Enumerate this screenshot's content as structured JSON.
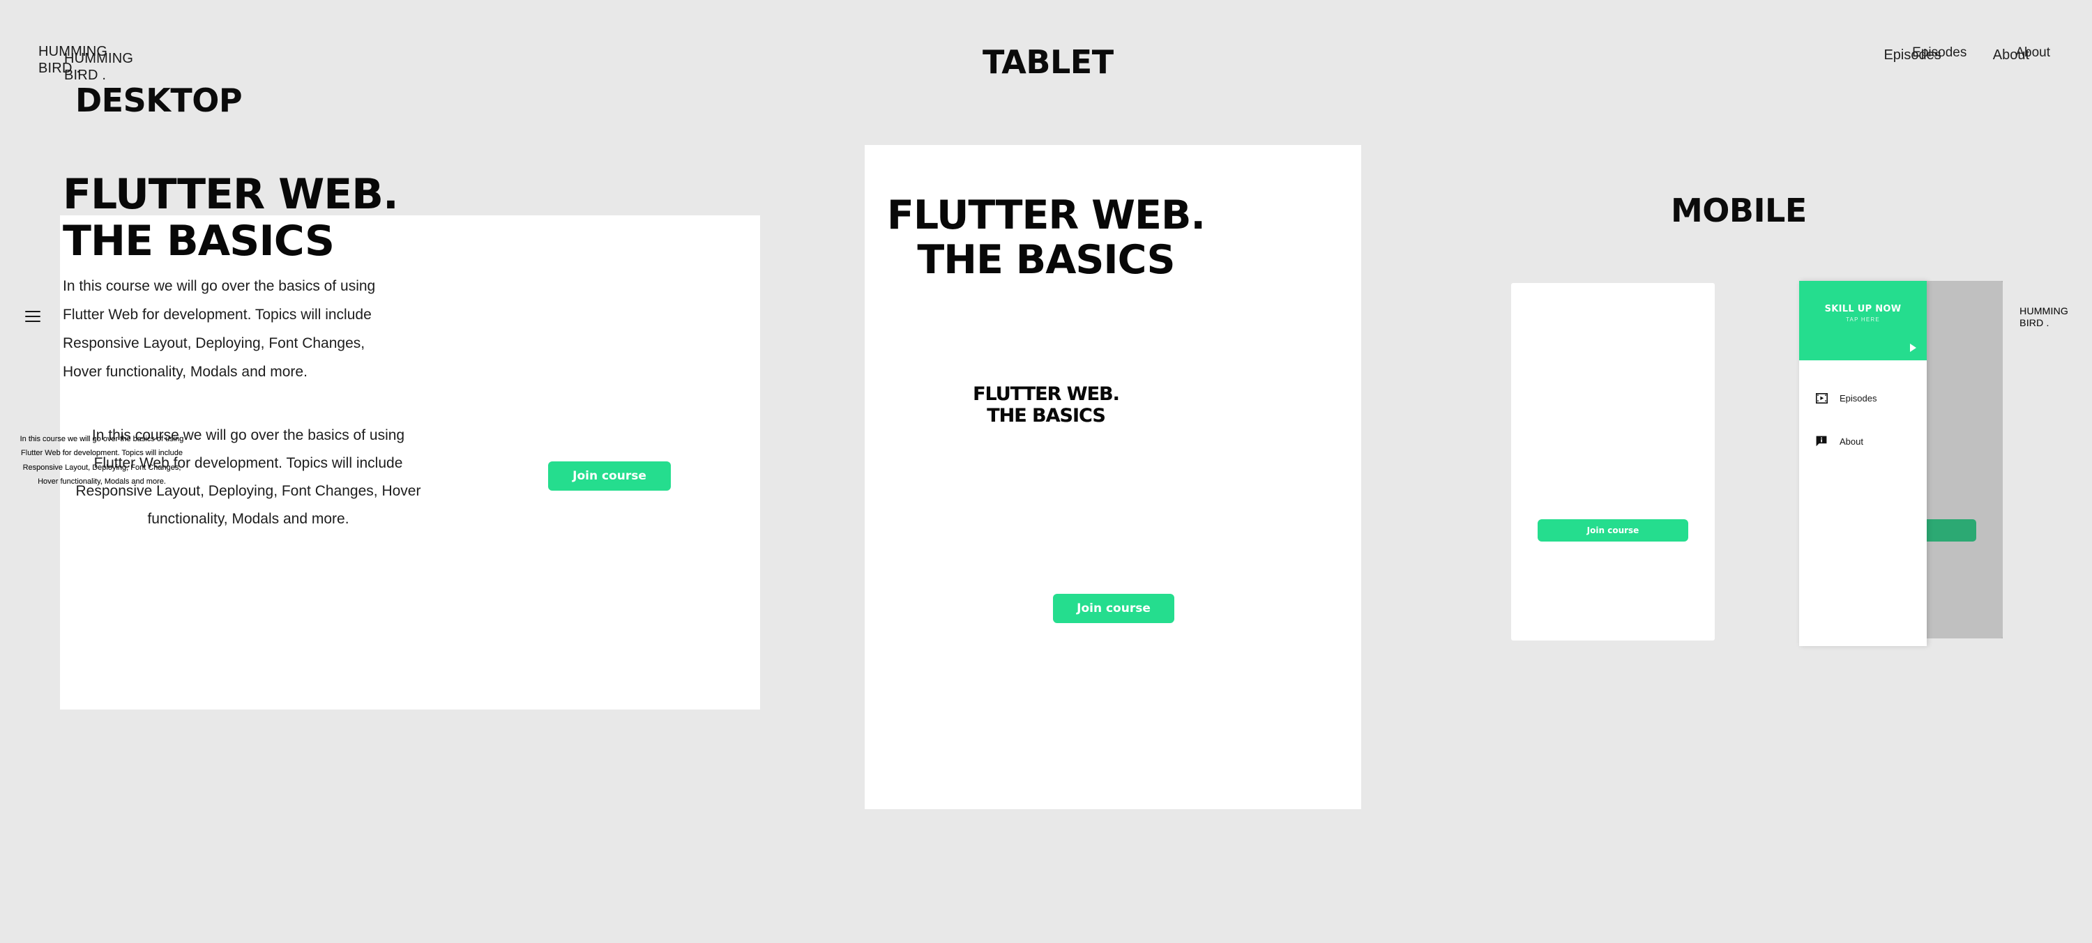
{
  "sections": {
    "desktop_label": "DESKTOP",
    "tablet_label": "TABLET",
    "mobile_label": "MOBILE"
  },
  "brand": {
    "logo": "HUMMING\nBIRD ."
  },
  "nav": {
    "episodes": "Episodes",
    "about": "About"
  },
  "hero": {
    "title": "FLUTTER WEB.\nTHE BASICS",
    "body": "In this course we will go over the basics of using Flutter Web for development. Topics will include Responsive Layout, Deploying, Font Changes, Hover functionality, Modals and more.",
    "cta_label": "Join course"
  },
  "drawer": {
    "title": "SKILL UP NOW",
    "subtitle": "TAP HERE",
    "play_icon": "play-icon",
    "items": [
      {
        "label": "Episodes",
        "icon": "film-icon"
      },
      {
        "label": "About",
        "icon": "info-bubble-icon"
      }
    ]
  },
  "icons": {
    "hamburger": "hamburger-menu-icon"
  },
  "colors": {
    "accent_green": "#25dd8e",
    "page_background": "#e8e8e8",
    "card_background": "#ffffff",
    "text_dark": "#0b0b0b"
  }
}
